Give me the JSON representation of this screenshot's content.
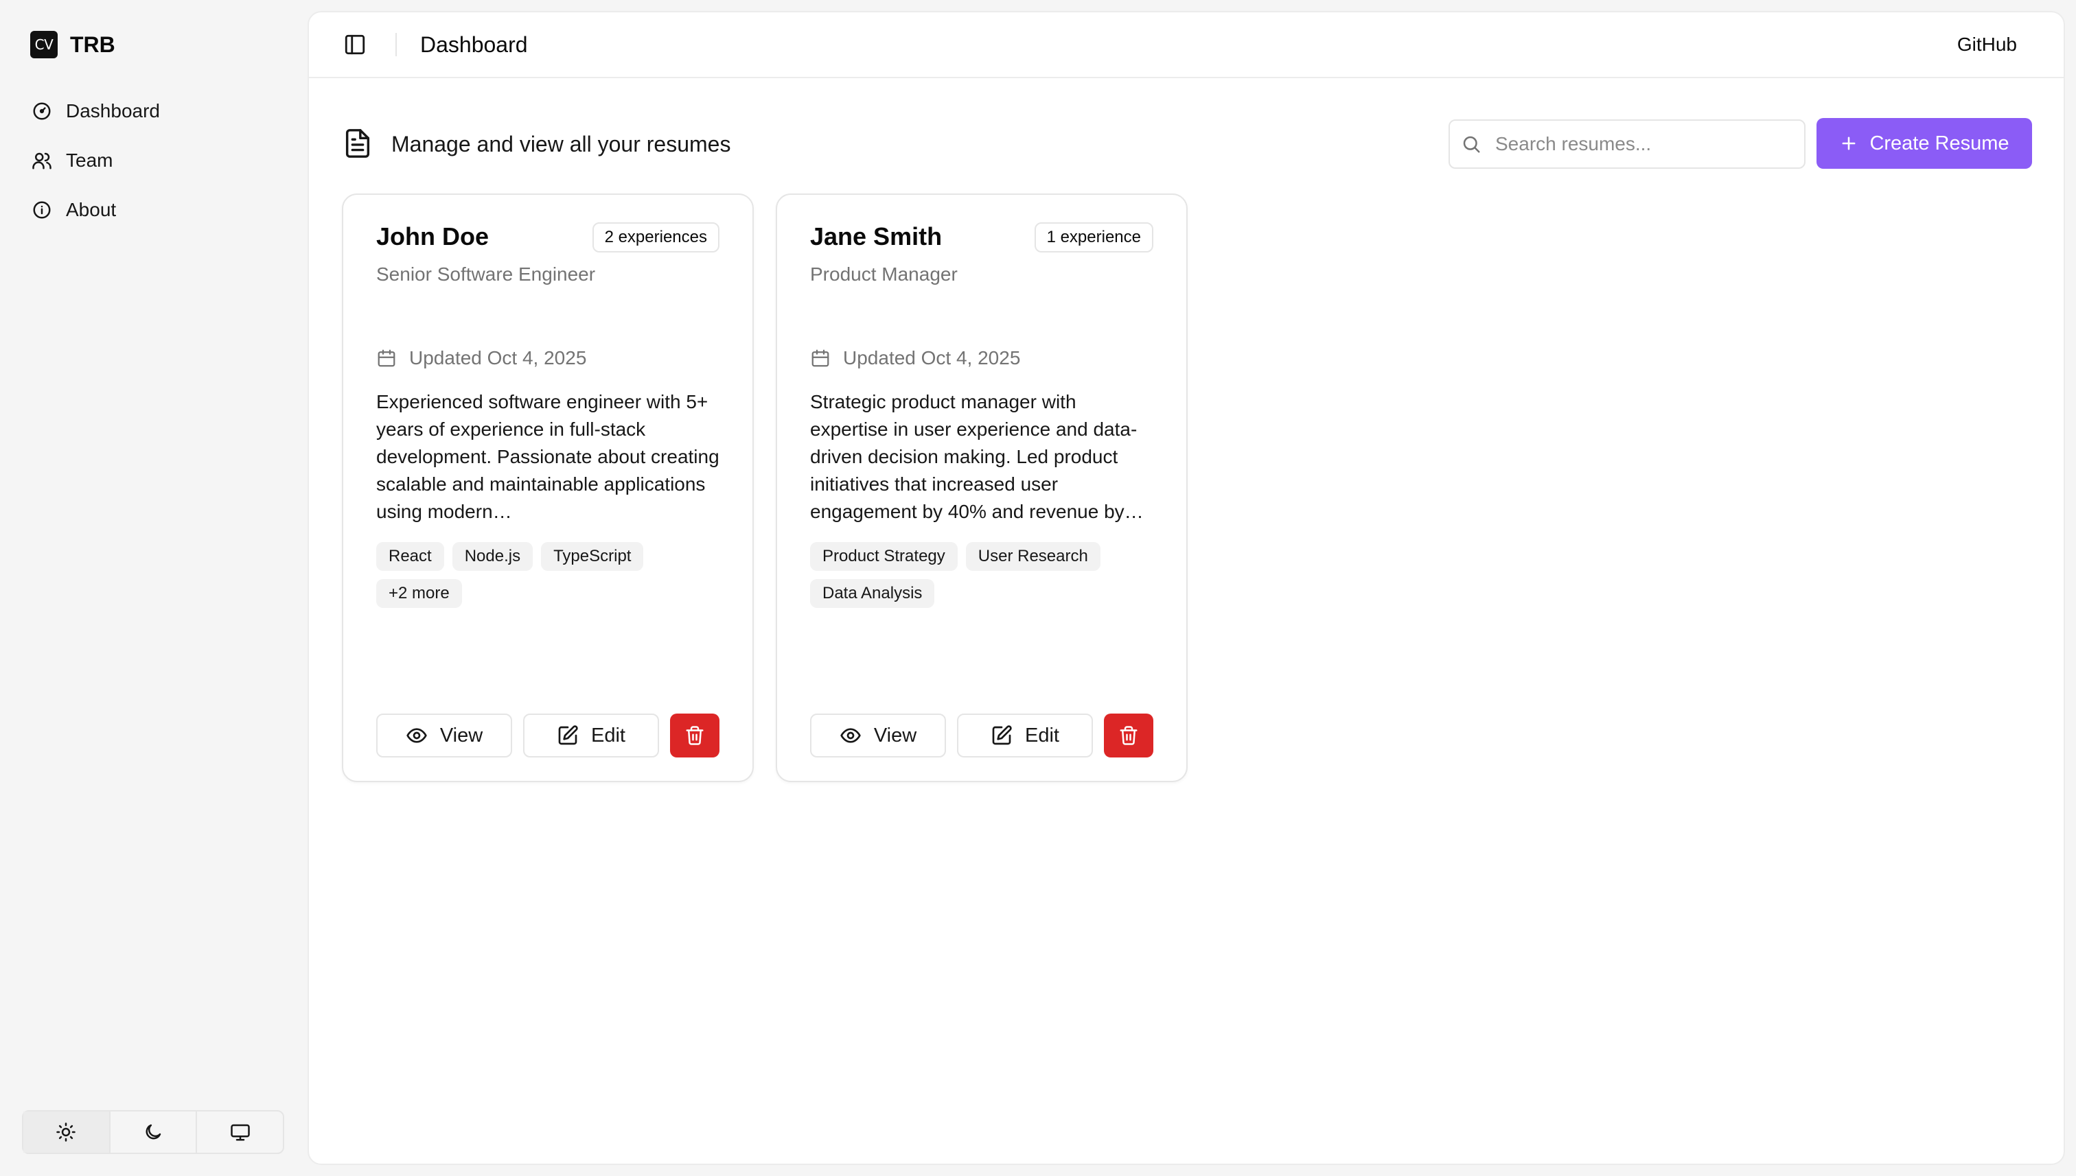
{
  "brand": {
    "logo_text": "CV",
    "name": "TRB"
  },
  "sidebar": {
    "items": [
      {
        "label": "Dashboard",
        "icon": "gauge-icon"
      },
      {
        "label": "Team",
        "icon": "users-icon"
      },
      {
        "label": "About",
        "icon": "info-icon"
      }
    ],
    "theme_options": [
      "light",
      "dark",
      "system"
    ]
  },
  "header": {
    "title": "Dashboard",
    "github_label": "GitHub"
  },
  "toolbar": {
    "subtitle": "Manage and view all your resumes",
    "search_placeholder": "Search resumes...",
    "create_label": "Create Resume"
  },
  "resumes": [
    {
      "name": "John Doe",
      "badge": "2 experiences",
      "role": "Senior Software Engineer",
      "updated": "Updated Oct 4, 2025",
      "summary": "Experienced software engineer with 5+ years of experience in full-stack development. Passionate about creating scalable and maintainable applications using modern…",
      "tags": [
        "React",
        "Node.js",
        "TypeScript",
        "+2 more"
      ],
      "view_label": "View",
      "edit_label": "Edit"
    },
    {
      "name": "Jane Smith",
      "badge": "1 experience",
      "role": "Product Manager",
      "updated": "Updated Oct 4, 2025",
      "summary": "Strategic product manager with expertise in user experience and data-driven decision making. Led product initiatives that increased user engagement by 40% and revenue by…",
      "tags": [
        "Product Strategy",
        "User Research",
        "Data Analysis"
      ],
      "view_label": "View",
      "edit_label": "Edit"
    }
  ],
  "colors": {
    "accent": "#8b5cf6",
    "danger": "#dc2626",
    "muted_text": "#737373"
  }
}
